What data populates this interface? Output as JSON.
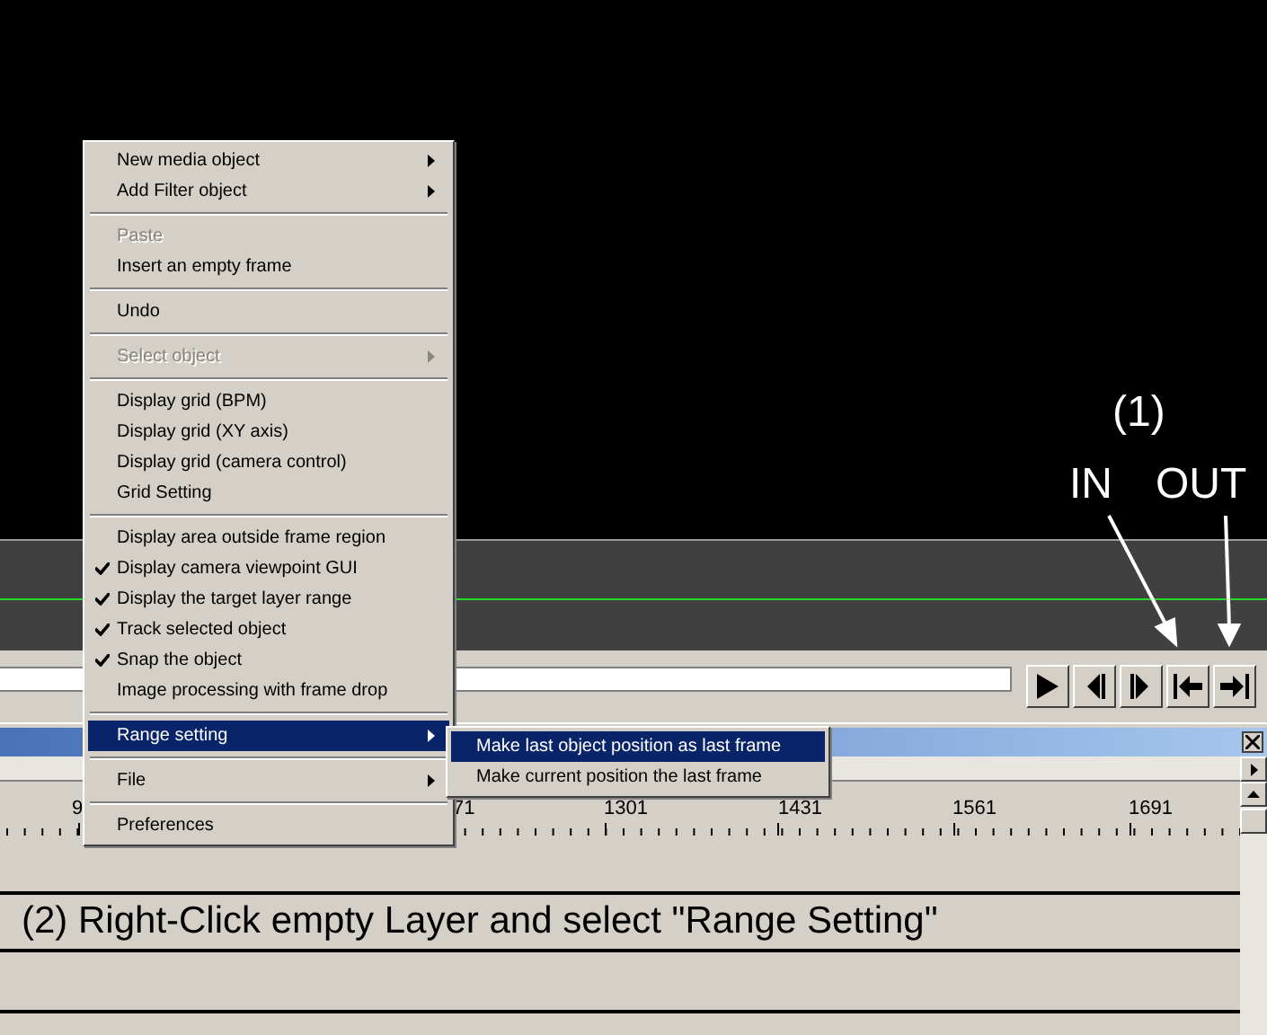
{
  "annotations": {
    "step_label": "(1)",
    "in_label": "IN",
    "out_label": "OUT",
    "instruction": "(2) Right-Click empty Layer and select \"Range Setting\""
  },
  "ruler": {
    "labels": [
      "9",
      "71",
      "1301",
      "1431",
      "1561",
      "1691"
    ]
  },
  "context_menu": {
    "items": [
      {
        "kind": "item",
        "label": "New media object",
        "submenu": true,
        "disabled": false,
        "checked": false,
        "selected": false
      },
      {
        "kind": "item",
        "label": "Add Filter object",
        "submenu": true,
        "disabled": false,
        "checked": false,
        "selected": false
      },
      {
        "kind": "separator"
      },
      {
        "kind": "item",
        "label": "Paste",
        "submenu": false,
        "disabled": true,
        "checked": false,
        "selected": false
      },
      {
        "kind": "item",
        "label": "Insert an empty frame",
        "submenu": false,
        "disabled": false,
        "checked": false,
        "selected": false
      },
      {
        "kind": "separator"
      },
      {
        "kind": "item",
        "label": "Undo",
        "submenu": false,
        "disabled": false,
        "checked": false,
        "selected": false
      },
      {
        "kind": "separator"
      },
      {
        "kind": "item",
        "label": "Select object",
        "submenu": true,
        "disabled": true,
        "checked": false,
        "selected": false
      },
      {
        "kind": "separator"
      },
      {
        "kind": "item",
        "label": "Display grid (BPM)",
        "submenu": false,
        "disabled": false,
        "checked": false,
        "selected": false
      },
      {
        "kind": "item",
        "label": "Display grid (XY axis)",
        "submenu": false,
        "disabled": false,
        "checked": false,
        "selected": false
      },
      {
        "kind": "item",
        "label": "Display grid (camera control)",
        "submenu": false,
        "disabled": false,
        "checked": false,
        "selected": false
      },
      {
        "kind": "item",
        "label": "Grid Setting",
        "submenu": false,
        "disabled": false,
        "checked": false,
        "selected": false
      },
      {
        "kind": "separator"
      },
      {
        "kind": "item",
        "label": "Display area outside frame region",
        "submenu": false,
        "disabled": false,
        "checked": false,
        "selected": false
      },
      {
        "kind": "item",
        "label": "Display camera viewpoint GUI",
        "submenu": false,
        "disabled": false,
        "checked": true,
        "selected": false
      },
      {
        "kind": "item",
        "label": "Display the target layer range",
        "submenu": false,
        "disabled": false,
        "checked": true,
        "selected": false
      },
      {
        "kind": "item",
        "label": "Track selected object",
        "submenu": false,
        "disabled": false,
        "checked": true,
        "selected": false
      },
      {
        "kind": "item",
        "label": "Snap the object",
        "submenu": false,
        "disabled": false,
        "checked": true,
        "selected": false
      },
      {
        "kind": "item",
        "label": "Image processing with frame drop",
        "submenu": false,
        "disabled": false,
        "checked": false,
        "selected": false
      },
      {
        "kind": "separator"
      },
      {
        "kind": "item",
        "label": "Range setting",
        "submenu": true,
        "disabled": false,
        "checked": false,
        "selected": true
      },
      {
        "kind": "separator"
      },
      {
        "kind": "item",
        "label": "File",
        "submenu": true,
        "disabled": false,
        "checked": false,
        "selected": false
      },
      {
        "kind": "separator"
      },
      {
        "kind": "item",
        "label": "Preferences",
        "submenu": false,
        "disabled": false,
        "checked": false,
        "selected": false
      }
    ]
  },
  "submenu": {
    "items": [
      {
        "label": "Make last object position as last frame",
        "selected": true
      },
      {
        "label": "Make current position the last frame",
        "selected": false
      }
    ]
  }
}
